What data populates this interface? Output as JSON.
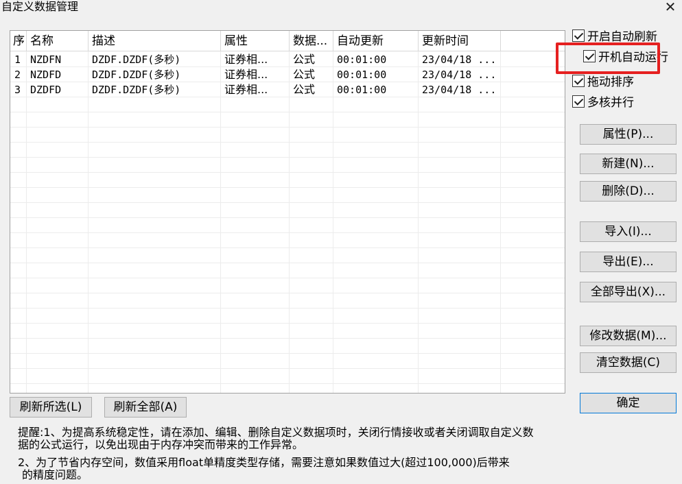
{
  "window": {
    "title": "自定义数据管理",
    "close_label": "✕"
  },
  "table": {
    "headers": [
      "序",
      "名称",
      "描述",
      "属性",
      "数据...",
      "自动更新",
      "更新时间"
    ],
    "rows": [
      [
        "1",
        "NZDFN",
        "DZDF.DZDF(多秒)",
        "证券相...",
        "公式",
        "00:01:00",
        "23/04/18 ..."
      ],
      [
        "2",
        "NZDFD",
        "DZDF.DZDF(多秒)",
        "证券相...",
        "公式",
        "00:01:00",
        "23/04/18 ..."
      ],
      [
        "3",
        "DZDFD",
        "DZDF.DZDF(多秒)",
        "证券相...",
        "公式",
        "00:01:00",
        "23/04/18 ..."
      ]
    ]
  },
  "options": {
    "auto_refresh": "开启自动刷新",
    "startup_run": "开机自动运行",
    "drag_sort": "拖动排序",
    "multicore": "多核并行"
  },
  "buttons": {
    "properties": "属性(P)...",
    "new": "新建(N)...",
    "delete": "删除(D)...",
    "import": "导入(I)...",
    "export": "导出(E)...",
    "export_all": "全部导出(X)...",
    "modify": "修改数据(M)...",
    "clear": "清空数据(C)",
    "ok": "确定",
    "refresh_selected": "刷新所选(L)",
    "refresh_all": "刷新全部(A)"
  },
  "notes": {
    "line1": "提醒:1、为提高系统稳定性，请在添加、编辑、删除自定义数据项时，关闭行情接收或者关闭调取自定义数",
    "line2": "据的公式运行，以免出现由于内存冲突而带来的工作异常。",
    "line3": "      2、为了节省内存空间，数值采用float单精度类型存储，需要注意如果数值过大(超过100,000)后带来",
    "line4": "的精度问题。"
  }
}
